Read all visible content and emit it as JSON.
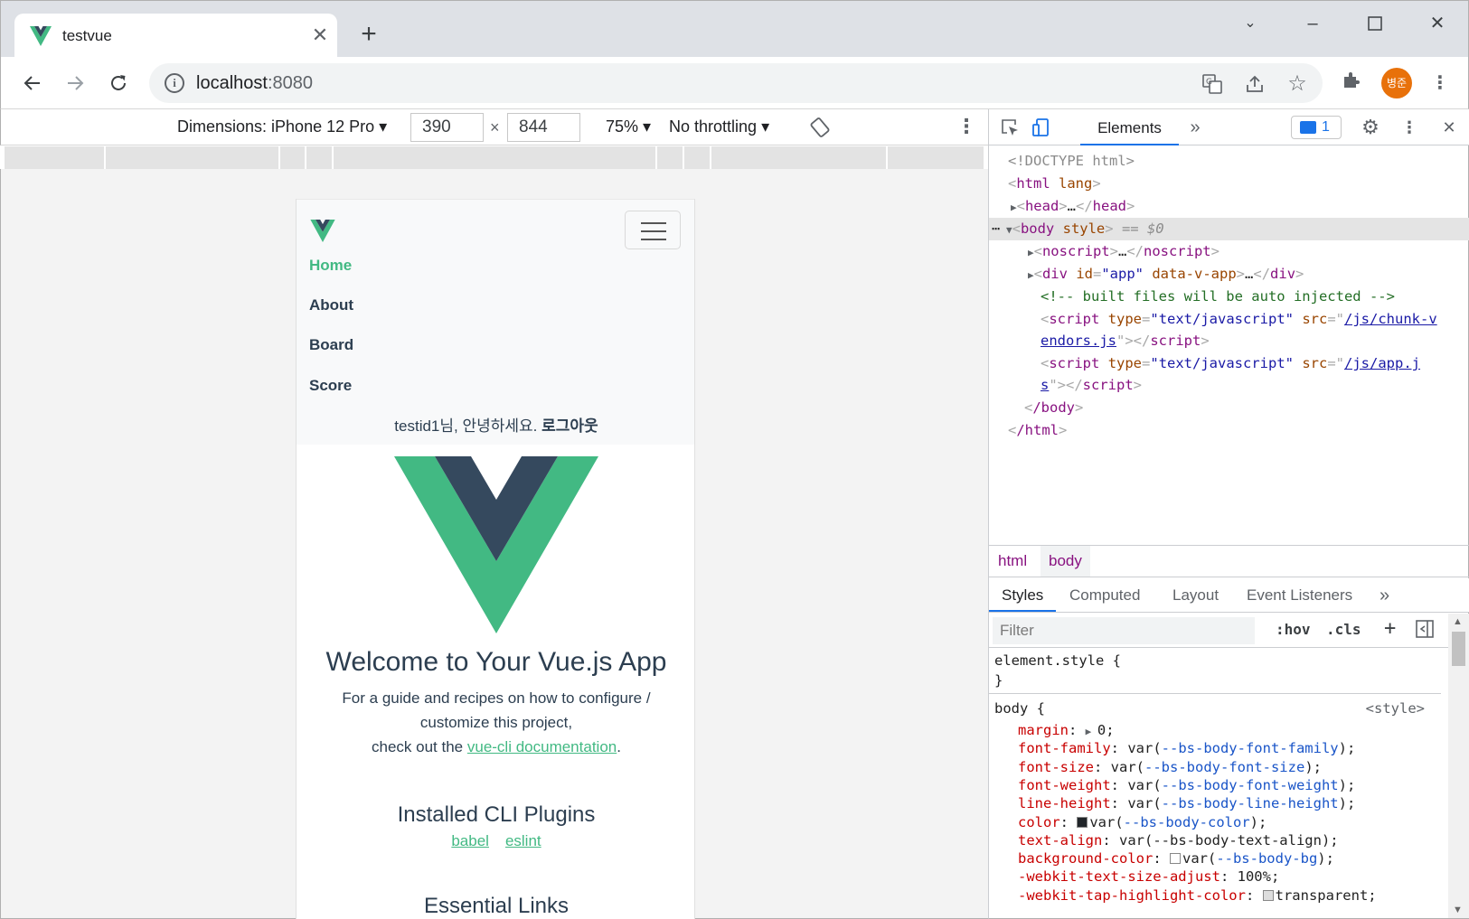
{
  "browser": {
    "tab_title": "testvue",
    "url_host": "localhost",
    "url_port": ":8080",
    "profile_initials": "병준"
  },
  "device_toolbar": {
    "dimensions_label": "Dimensions: iPhone 12 Pro",
    "width": "390",
    "height": "844",
    "times": "×",
    "zoom": "75%",
    "throttling": "No throttling"
  },
  "phone_page": {
    "nav": {
      "links": [
        "Home",
        "About",
        "Board",
        "Score"
      ],
      "active_index": 0,
      "greeting": "testid1님, 안녕하세요.",
      "logout": "로그아웃"
    },
    "welcome_title": "Welcome to Your Vue.js App",
    "guide_line1": "For a guide and recipes on how to configure /",
    "guide_line2": "customize this project,",
    "guide_line3_prefix": "check out the ",
    "guide_link": "vue-cli documentation",
    "guide_line3_suffix": ".",
    "plugins_title": "Installed CLI Plugins",
    "plugins": [
      "babel",
      "eslint"
    ],
    "essential_links_title": "Essential Links"
  },
  "devtools": {
    "active_tab": "Elements",
    "message_count": "1",
    "dom": {
      "doctype": "<!DOCTYPE html>",
      "html_open": "html",
      "html_attr": "lang",
      "head": "head",
      "body": "body",
      "body_attr": "style",
      "selected_marker": "== $0",
      "noscript": "noscript",
      "div_id_attr": "id",
      "div_id_val": "\"app\"",
      "div_attr2": "data-v-app",
      "comment": "<!-- built files will be auto injected -->",
      "script_type_attr": "type",
      "script_type_val": "\"text/javascript\"",
      "script_src_attr": "src",
      "script1_src_a": "/js/chunk-v",
      "script1_src_b": "endors.js",
      "script2_src_a": "/js/app.j",
      "script2_src_b": "s",
      "body_close": "/body",
      "html_close": "/html"
    },
    "breadcrumbs": [
      "html",
      "body"
    ],
    "styles_tabs": [
      "Styles",
      "Computed",
      "Layout",
      "Event Listeners"
    ],
    "filter_placeholder": "Filter",
    "hov": ":hov",
    "cls": ".cls",
    "element_style": "element.style {",
    "close_brace": "}",
    "body_rule": "body {",
    "body_rule_source": "<style>",
    "properties": [
      {
        "name": "margin",
        "value": "0;"
      },
      {
        "name": "font-family",
        "fn": "var(",
        "var": "--bs-body-font-family",
        "end": ");"
      },
      {
        "name": "font-size",
        "fn": "var(",
        "var": "--bs-body-font-size",
        "end": ");"
      },
      {
        "name": "font-weight",
        "fn": "var(",
        "var": "--bs-body-font-weight",
        "end": ");"
      },
      {
        "name": "line-height",
        "fn": "var(",
        "var": "--bs-body-line-height",
        "end": ");"
      },
      {
        "name": "color",
        "fn": "var(",
        "var": "--bs-body-color",
        "end": ");"
      },
      {
        "name": "text-align",
        "value": "var(--bs-body-text-align);"
      },
      {
        "name": "background-color",
        "fn": "var(",
        "var": "--bs-body-bg",
        "end": ");"
      },
      {
        "name": "-webkit-text-size-adjust",
        "value": "100%;"
      },
      {
        "name": "-webkit-tap-highlight-color",
        "value": "transparent;"
      }
    ]
  },
  "colors": {
    "vue_green": "#42b983",
    "vue_dark": "#35495e",
    "accent_blue": "#1a73e8"
  }
}
